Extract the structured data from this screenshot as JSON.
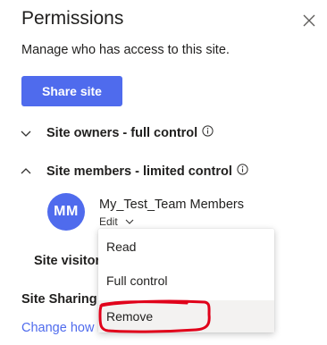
{
  "panel": {
    "title": "Permissions",
    "description": "Manage who has access to this site.",
    "share_button": "Share site",
    "close_icon": "close-icon"
  },
  "groups": [
    {
      "label": "Site owners - full control",
      "expanded": false
    },
    {
      "label": "Site members - limited control",
      "expanded": true
    },
    {
      "label": "Site visitors - read",
      "expanded": false
    }
  ],
  "member": {
    "initials": "MM",
    "name": "My_Test_Team Members",
    "permission": "Edit"
  },
  "dropdown": {
    "items": [
      "Read",
      "Full control",
      "Remove"
    ],
    "hovered_item": "Remove"
  },
  "site_sharing": {
    "heading": "Site Sharing",
    "link": "Change how"
  },
  "colors": {
    "accent": "#4f6bed",
    "annotation": "#e0001a",
    "hover": "#f3f2f1"
  }
}
